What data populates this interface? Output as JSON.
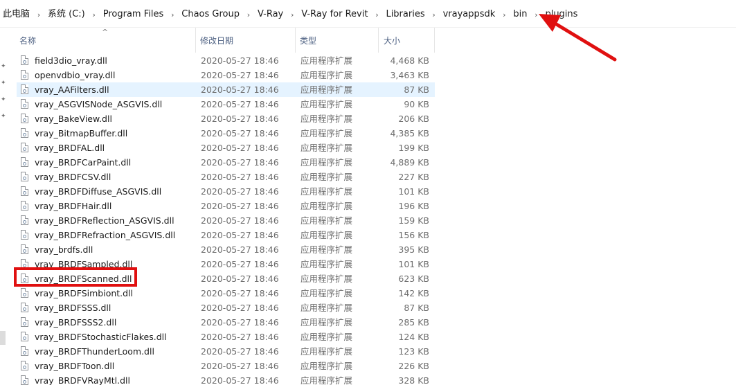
{
  "breadcrumb": [
    "此电脑",
    "系统 (C:)",
    "Program Files",
    "Chaos Group",
    "V-Ray",
    "V-Ray for Revit",
    "Libraries",
    "vrayappsdk",
    "bin",
    "plugins"
  ],
  "breadcrumb_separator": "›",
  "columns": {
    "name": "名称",
    "date": "修改日期",
    "type": "类型",
    "size": "大小"
  },
  "sort_indicator": "^",
  "nav_pin_glyph": "✦",
  "files": [
    {
      "name": "field3dio_vray.dll",
      "date": "2020-05-27 18:46",
      "type": "应用程序扩展",
      "size": "4,468 KB"
    },
    {
      "name": "openvdbio_vray.dll",
      "date": "2020-05-27 18:46",
      "type": "应用程序扩展",
      "size": "3,463 KB"
    },
    {
      "name": "vray_AAFilters.dll",
      "date": "2020-05-27 18:46",
      "type": "应用程序扩展",
      "size": "87 KB"
    },
    {
      "name": "vray_ASGVISNode_ASGVIS.dll",
      "date": "2020-05-27 18:46",
      "type": "应用程序扩展",
      "size": "90 KB"
    },
    {
      "name": "vray_BakeView.dll",
      "date": "2020-05-27 18:46",
      "type": "应用程序扩展",
      "size": "206 KB"
    },
    {
      "name": "vray_BitmapBuffer.dll",
      "date": "2020-05-27 18:46",
      "type": "应用程序扩展",
      "size": "4,385 KB"
    },
    {
      "name": "vray_BRDFAL.dll",
      "date": "2020-05-27 18:46",
      "type": "应用程序扩展",
      "size": "199 KB"
    },
    {
      "name": "vray_BRDFCarPaint.dll",
      "date": "2020-05-27 18:46",
      "type": "应用程序扩展",
      "size": "4,889 KB"
    },
    {
      "name": "vray_BRDFCSV.dll",
      "date": "2020-05-27 18:46",
      "type": "应用程序扩展",
      "size": "227 KB"
    },
    {
      "name": "vray_BRDFDiffuse_ASGVIS.dll",
      "date": "2020-05-27 18:46",
      "type": "应用程序扩展",
      "size": "101 KB"
    },
    {
      "name": "vray_BRDFHair.dll",
      "date": "2020-05-27 18:46",
      "type": "应用程序扩展",
      "size": "196 KB"
    },
    {
      "name": "vray_BRDFReflection_ASGVIS.dll",
      "date": "2020-05-27 18:46",
      "type": "应用程序扩展",
      "size": "159 KB"
    },
    {
      "name": "vray_BRDFRefraction_ASGVIS.dll",
      "date": "2020-05-27 18:46",
      "type": "应用程序扩展",
      "size": "156 KB"
    },
    {
      "name": "vray_brdfs.dll",
      "date": "2020-05-27 18:46",
      "type": "应用程序扩展",
      "size": "395 KB"
    },
    {
      "name": "vray_BRDFSampled.dll",
      "date": "2020-05-27 18:46",
      "type": "应用程序扩展",
      "size": "101 KB"
    },
    {
      "name": "vray_BRDFScanned.dll",
      "date": "2020-05-27 18:46",
      "type": "应用程序扩展",
      "size": "623 KB"
    },
    {
      "name": "vray_BRDFSimbiont.dll",
      "date": "2020-05-27 18:46",
      "type": "应用程序扩展",
      "size": "142 KB"
    },
    {
      "name": "vray_BRDFSSS.dll",
      "date": "2020-05-27 18:46",
      "type": "应用程序扩展",
      "size": "87 KB"
    },
    {
      "name": "vray_BRDFSSS2.dll",
      "date": "2020-05-27 18:46",
      "type": "应用程序扩展",
      "size": "285 KB"
    },
    {
      "name": "vray_BRDFStochasticFlakes.dll",
      "date": "2020-05-27 18:46",
      "type": "应用程序扩展",
      "size": "124 KB"
    },
    {
      "name": "vray_BRDFThunderLoom.dll",
      "date": "2020-05-27 18:46",
      "type": "应用程序扩展",
      "size": "123 KB"
    },
    {
      "name": "vray_BRDFToon.dll",
      "date": "2020-05-27 18:46",
      "type": "应用程序扩展",
      "size": "226 KB"
    },
    {
      "name": "vray_BRDFVRayMtl.dll",
      "date": "2020-05-27 18:46",
      "type": "应用程序扩展",
      "size": "328 KB"
    }
  ],
  "selected_row": 2,
  "highlighted_row": 15,
  "colors": {
    "selection": "#e5f3ff",
    "annotation_red": "#e01010",
    "header_text": "#4d6082"
  },
  "icons": {
    "file": "dll-file-icon",
    "sort": "sort-up-icon",
    "pin": "pin-icon",
    "separator": "chevron-right-icon"
  }
}
